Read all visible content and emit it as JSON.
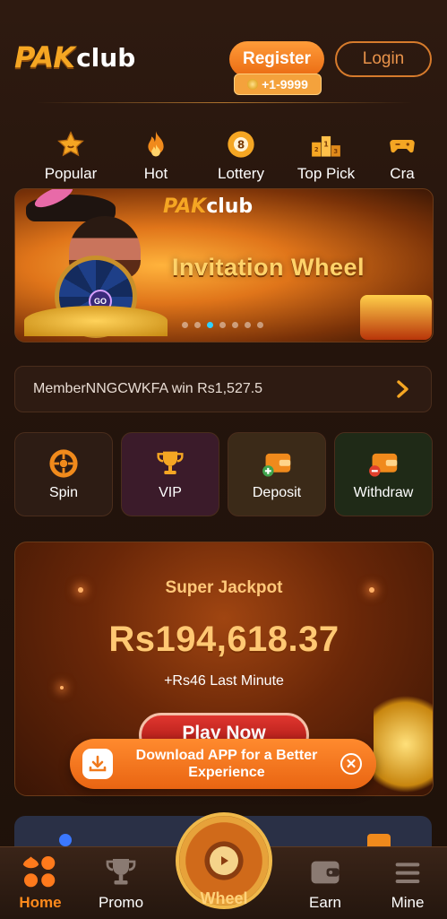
{
  "header": {
    "logo_main": "PAK",
    "logo_sub": "club",
    "register_label": "Register",
    "bonus_label": "+1-9999",
    "login_label": "Login"
  },
  "categories": [
    {
      "label": "Popular",
      "icon": "star-icon"
    },
    {
      "label": "Hot",
      "icon": "flame-icon"
    },
    {
      "label": "Lottery",
      "icon": "billiard-ball-icon"
    },
    {
      "label": "Top Pick",
      "icon": "podium-icon"
    },
    {
      "label": "Cra",
      "icon": "controller-icon"
    }
  ],
  "banner": {
    "logo_main": "PAK",
    "logo_sub": "club",
    "title": "Invitation Wheel",
    "wheel_center": "GO",
    "slide_count": 7,
    "active_slide": 3
  },
  "notice": {
    "text": "MemberNNGCWKFA win Rs1,527.5"
  },
  "actions": [
    {
      "label": "Spin",
      "icon": "spin-icon",
      "bg": "#2d1c14"
    },
    {
      "label": "VIP",
      "icon": "trophy-icon",
      "bg": "#3b1b2a"
    },
    {
      "label": "Deposit",
      "icon": "wallet-plus-icon",
      "bg": "#3b2a18"
    },
    {
      "label": "Withdraw",
      "icon": "wallet-minus-icon",
      "bg": "#1f2a17"
    }
  ],
  "jackpot": {
    "title": "Super Jackpot",
    "amount": "Rs194,618.37",
    "sub": "+Rs46 Last Minute",
    "play_label": "Play Now"
  },
  "download": {
    "text": "Download APP for a Better Experience",
    "close_label": "✕"
  },
  "nav": {
    "home": "Home",
    "promo": "Promo",
    "wheel": "Wheel",
    "earn": "Earn",
    "mine": "Mine"
  },
  "colors": {
    "accent": "#ff8a1c",
    "gold": "#ffc873",
    "background": "#24140c"
  }
}
